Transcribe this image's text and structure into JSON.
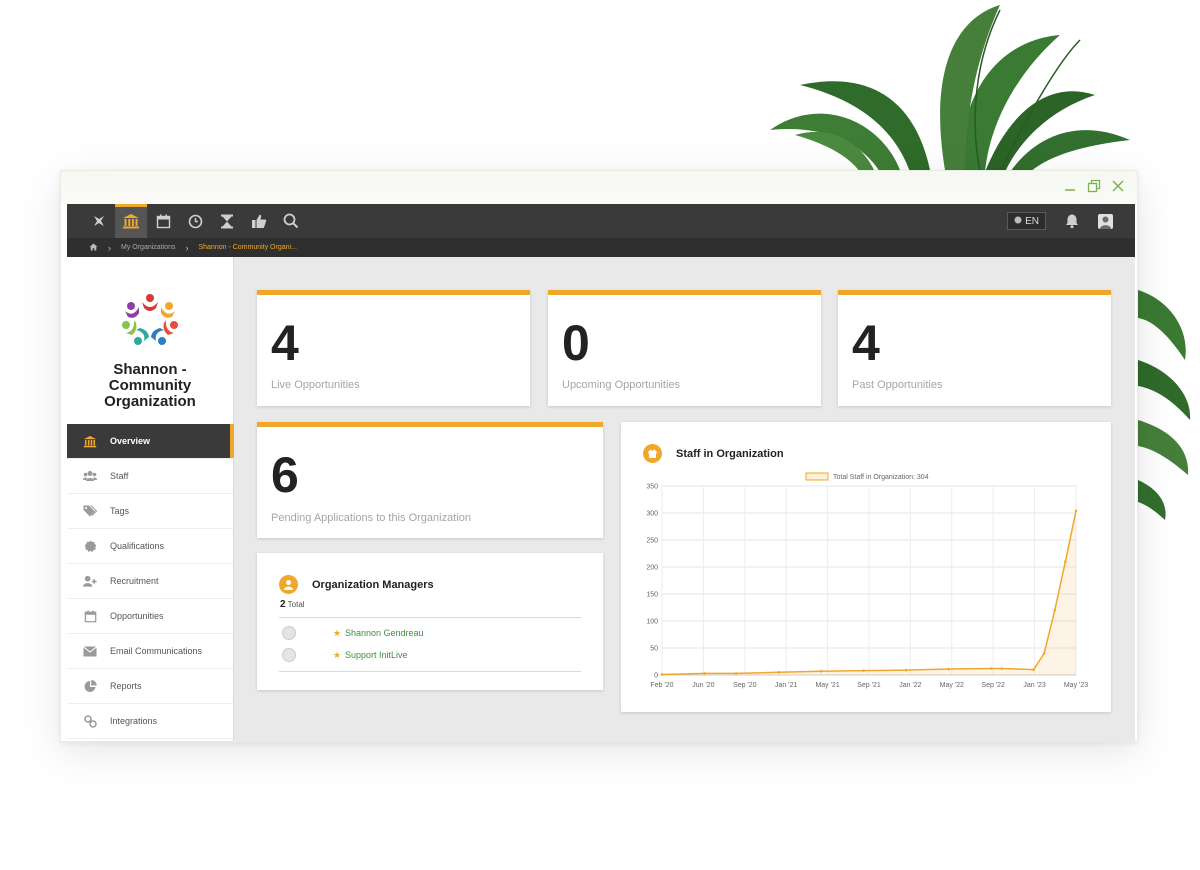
{
  "topbar": {
    "nav_icons": [
      "plane-icon",
      "institution-icon",
      "calendar-icon",
      "clock-icon",
      "hourglass-icon",
      "thumbs-up-icon",
      "search-icon"
    ],
    "active_nav": "institution-icon",
    "language": "EN"
  },
  "breadcrumb": {
    "home_icon": "home-icon",
    "items": [
      "My Organizations",
      "Shannon - Community Organi..."
    ]
  },
  "sidebar": {
    "org_name": "Shannon - Community Organization",
    "menu": [
      {
        "label": "Overview",
        "icon": "institution-icon",
        "active": true
      },
      {
        "label": "Staff",
        "icon": "users-icon"
      },
      {
        "label": "Tags",
        "icon": "tags-icon"
      },
      {
        "label": "Qualifications",
        "icon": "badge-icon"
      },
      {
        "label": "Recruitment",
        "icon": "user-plus-icon"
      },
      {
        "label": "Opportunities",
        "icon": "calendar-icon"
      },
      {
        "label": "Email Communications",
        "icon": "envelope-icon"
      },
      {
        "label": "Reports",
        "icon": "pie-chart-icon"
      },
      {
        "label": "Integrations",
        "icon": "link-icon"
      }
    ]
  },
  "stats": [
    {
      "value": "4",
      "label": "Live Opportunities"
    },
    {
      "value": "0",
      "label": "Upcoming Opportunities"
    },
    {
      "value": "4",
      "label": "Past Opportunities"
    },
    {
      "value": "6",
      "label": "Pending Applications to this Organization"
    }
  ],
  "managers": {
    "title": "Organization Managers",
    "total_count": "2",
    "total_label": "Total",
    "people": [
      "Shannon Gendreau",
      "Support InitLive"
    ]
  },
  "colors": {
    "accent": "#f0a82a",
    "dark": "#3a3a3a",
    "link": "#3f8f3f"
  },
  "chart_data": {
    "type": "area",
    "title": "Staff in Organization",
    "legend": "Total Staff in Organization: 304",
    "legend_position": "top",
    "grid": true,
    "x_ticks": [
      "Feb '20",
      "Jun '20",
      "Sep '20",
      "Jan '21",
      "May '21",
      "Sep '21",
      "Jan '22",
      "May '22",
      "Sep '22",
      "Jan '23",
      "May '23"
    ],
    "ylim": [
      0,
      350
    ],
    "y_ticks": [
      0,
      50,
      100,
      150,
      200,
      250,
      300,
      350
    ],
    "series": [
      {
        "name": "Total Staff in Organization: 304",
        "x": [
          "2020-02",
          "2020-06",
          "2020-09",
          "2021-01",
          "2021-05",
          "2021-09",
          "2022-01",
          "2022-05",
          "2022-09",
          "2022-10",
          "2023-01",
          "2023-02",
          "2023-03",
          "2023-04",
          "2023-05"
        ],
        "y": [
          1,
          3,
          3,
          5,
          7,
          8,
          9,
          11,
          12,
          12,
          10,
          40,
          120,
          210,
          304
        ]
      }
    ]
  }
}
